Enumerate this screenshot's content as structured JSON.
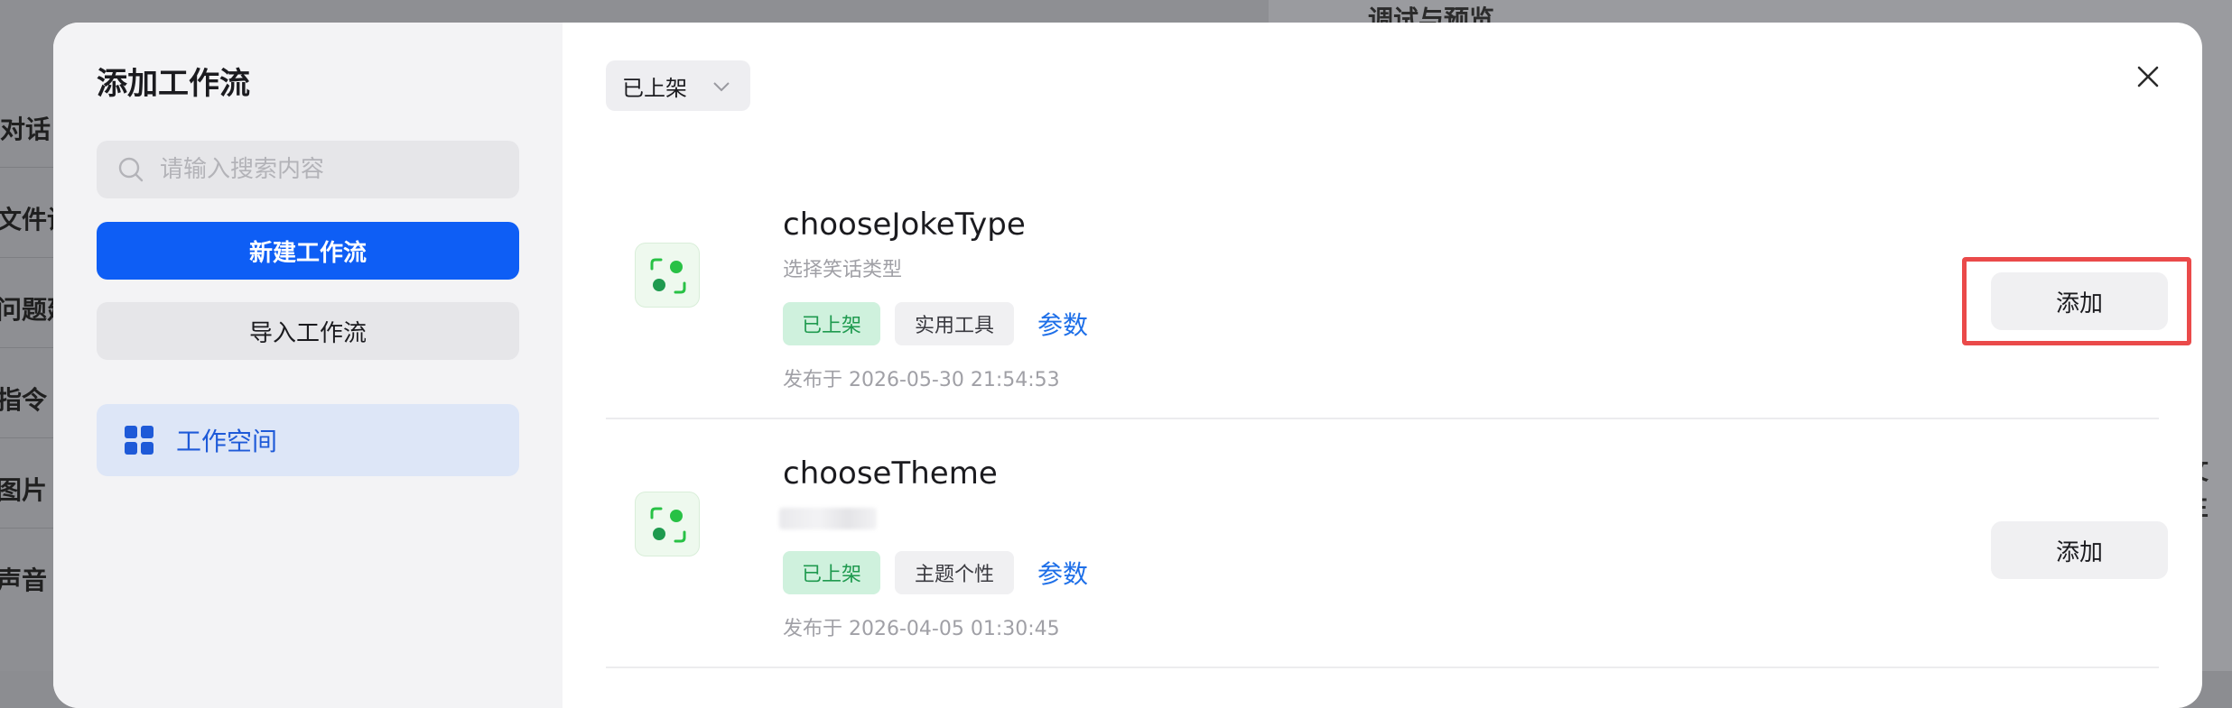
{
  "background": {
    "right_panel_title": "调试与预览",
    "left_items": [
      "对话",
      "文件设",
      "问题建",
      "指令（",
      "图片",
      "声音"
    ],
    "right_edge_text": "文生"
  },
  "modal": {
    "title": "添加工作流",
    "search_placeholder": "请输入搜索内容",
    "new_button": "新建工作流",
    "import_button": "导入工作流",
    "nav_items": [
      {
        "label": "工作空间",
        "icon": "grid-icon",
        "active": true
      }
    ],
    "filter_label": "已上架",
    "close_icon": "close-icon",
    "colors": {
      "primary": "#0e5ef5",
      "status_green": "#1f9a4f",
      "link": "#1e6fe8",
      "highlight": "#ea4a4a"
    },
    "workflows": [
      {
        "name": "chooseJokeType",
        "description": "选择笑话类型",
        "status_tag": "已上架",
        "category_tag": "实用工具",
        "params_link": "参数",
        "published": "发布于 2026-05-30 21:54:53",
        "add_label": "添加",
        "highlighted": true
      },
      {
        "name": "chooseTheme",
        "description": "",
        "status_tag": "已上架",
        "category_tag": "主题个性",
        "params_link": "参数",
        "published": "发布于 2026-04-05 01:30:45",
        "add_label": "添加",
        "highlighted": false
      }
    ]
  }
}
